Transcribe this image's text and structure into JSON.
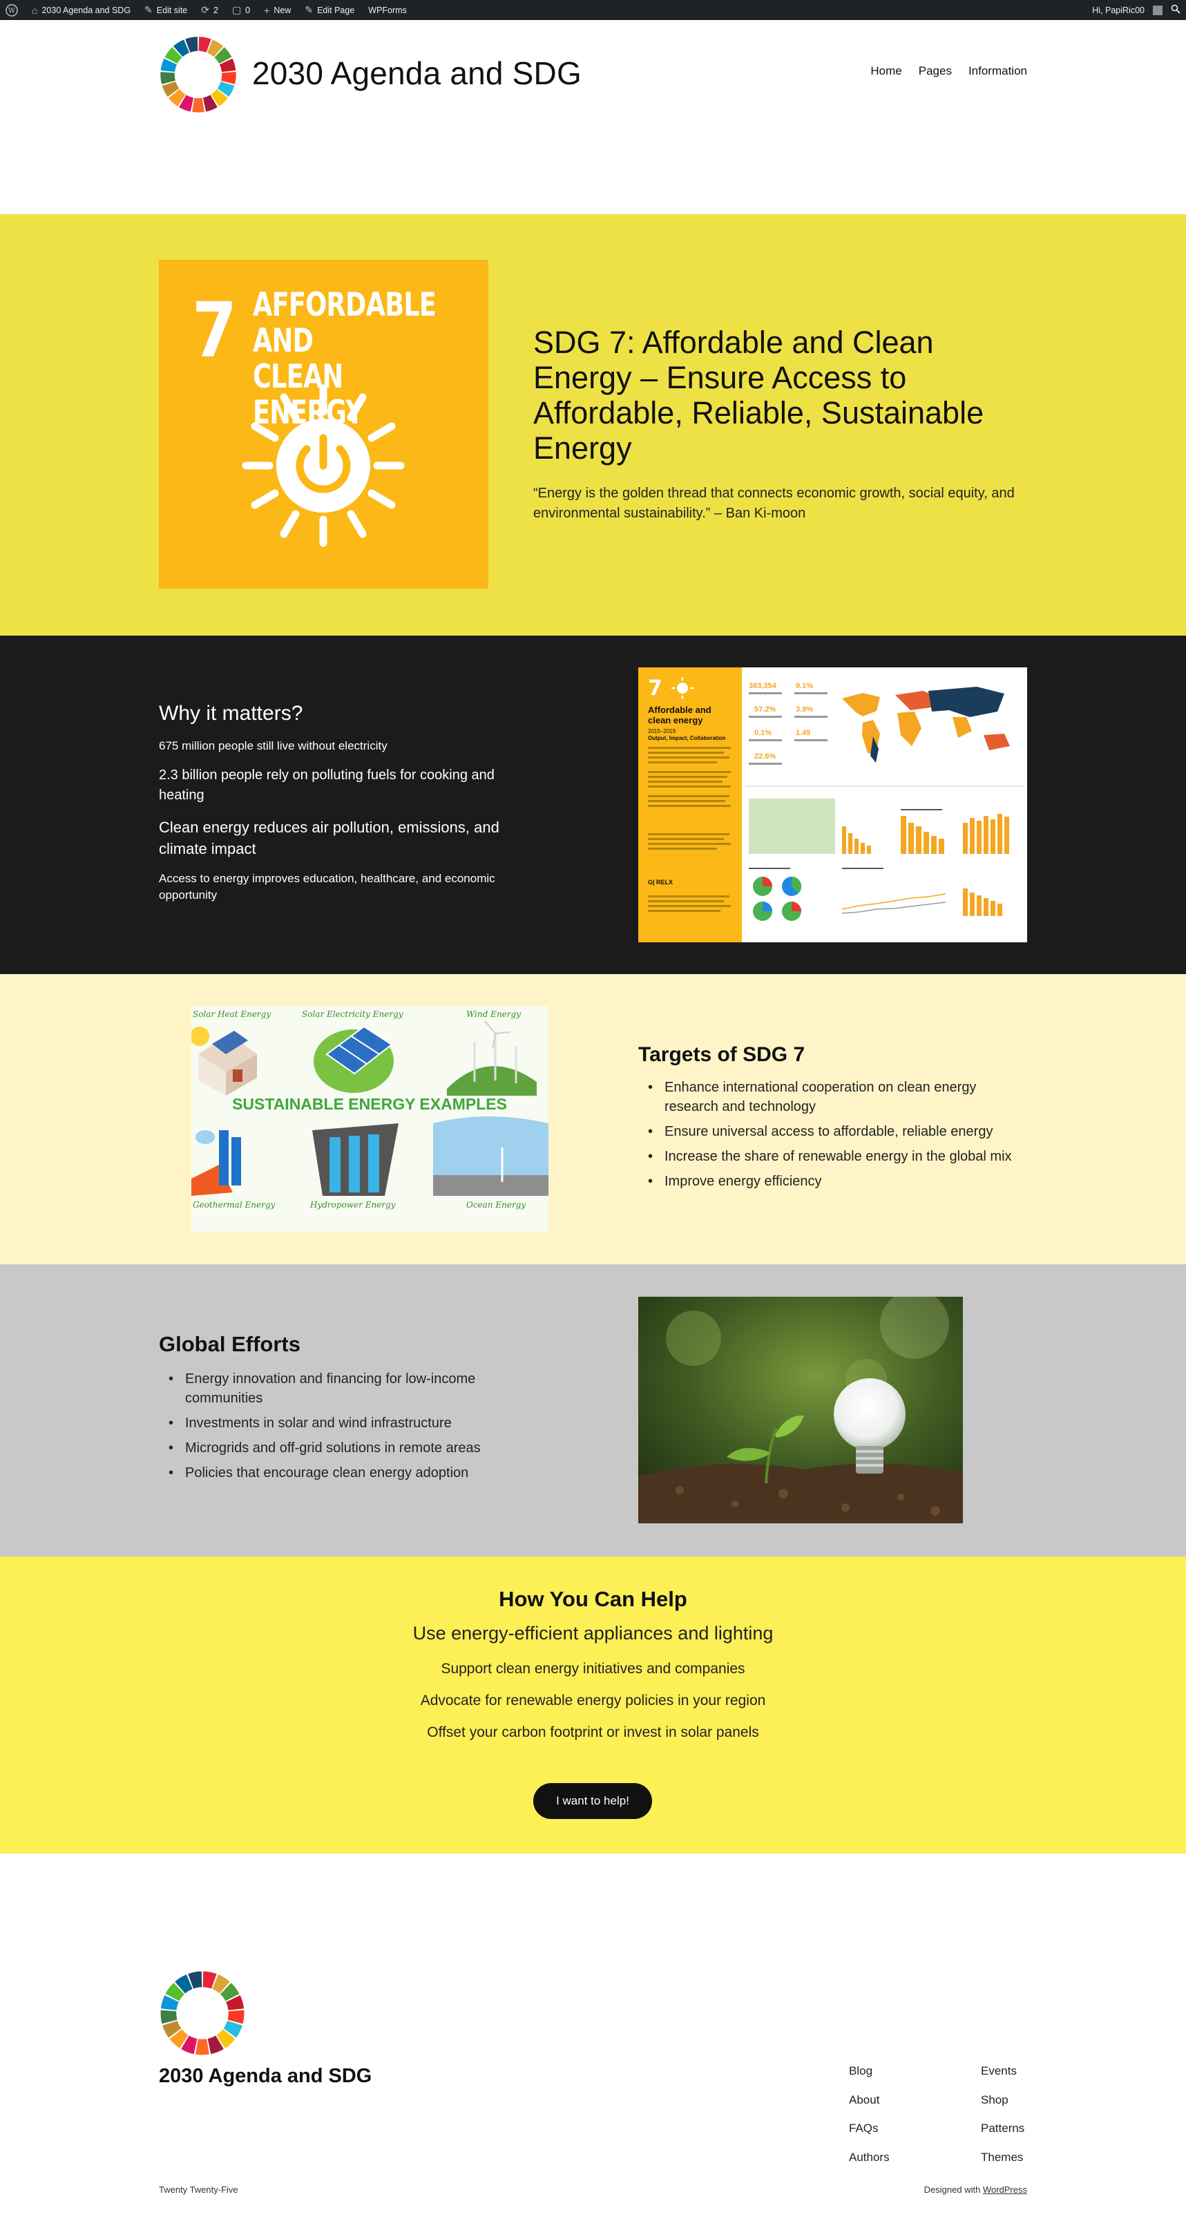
{
  "adminbar": {
    "site_name": "2030 Agenda and SDG",
    "edit_site": "Edit site",
    "updates_count": "2",
    "comments_count": "0",
    "new_label": "New",
    "edit_page": "Edit Page",
    "wpforms": "WPForms",
    "greeting": "Hi, PapiRic00"
  },
  "header": {
    "site_title": "2030 Agenda and SDG",
    "nav": [
      "Home",
      "Pages",
      "Information"
    ]
  },
  "hero": {
    "tile_number": "7",
    "tile_title_line1": "AFFORDABLE AND",
    "tile_title_line2": "CLEAN ENERGY",
    "title": "SDG 7: Affordable and Clean Energy – Ensure Access to Affordable, Reliable, Sustainable Energy",
    "quote": "“Energy is the golden thread that connects economic growth, social equity, and environmental sustainability.” – Ban Ki-moon",
    "tile_color": "#fbb816",
    "background": "#ede146"
  },
  "why": {
    "title": "Why it matters?",
    "line1": "675 million people still live without electricity",
    "line2": "2.3 billion people rely on polluting fuels for cooking and heating",
    "line3": "Clean energy reduces air pollution, emissions, and climate impact",
    "line4": "Access to energy improves education, healthcare, and economic opportunity"
  },
  "infographic": {
    "tile_number": "7",
    "title_line1": "Affordable and",
    "title_line2": "clean energy",
    "years": "2015–2019",
    "subtitle": "Output, Impact, Collaboration",
    "stats": [
      "383,354",
      "9.1%",
      "57.2%",
      "3.9%",
      "0.1%",
      "1.49",
      "22.6%"
    ],
    "footer_label": "G| RELX"
  },
  "targets": {
    "image_caption": "SUSTAINABLE ENERGY EXAMPLES",
    "image_labels": [
      "Solar Heat Energy",
      "Solar Electricity Energy",
      "Wind Energy",
      "Geothermal Energy",
      "Hydropower Energy",
      "Ocean Energy"
    ],
    "title": "Targets of SDG 7",
    "items": [
      "Enhance international cooperation on clean energy research and technology",
      "Ensure universal access to affordable, reliable energy",
      "Increase the share of renewable energy in the global mix",
      "Improve energy efficiency"
    ]
  },
  "global": {
    "title": "Global Efforts",
    "items": [
      "Energy innovation and financing for low-income communities",
      "Investments in solar and wind infrastructure",
      "Microgrids and off-grid solutions in remote areas",
      "Policies that encourage clean energy adoption"
    ]
  },
  "help": {
    "title": "How You Can Help",
    "subtitle": "Use energy-efficient appliances and lighting",
    "lines": [
      "Support clean energy initiatives and companies",
      "Advocate for renewable energy policies in your region",
      "Offset your carbon footprint or invest in solar panels"
    ],
    "button": "I want to help!"
  },
  "footer": {
    "site_title": "2030 Agenda and SDG",
    "col1": [
      "Blog",
      "About",
      "FAQs",
      "Authors"
    ],
    "col2": [
      "Events",
      "Shop",
      "Patterns",
      "Themes"
    ],
    "theme_name": "Twenty Twenty-Five",
    "designed_with": "Designed with",
    "wordpress": "WordPress"
  }
}
